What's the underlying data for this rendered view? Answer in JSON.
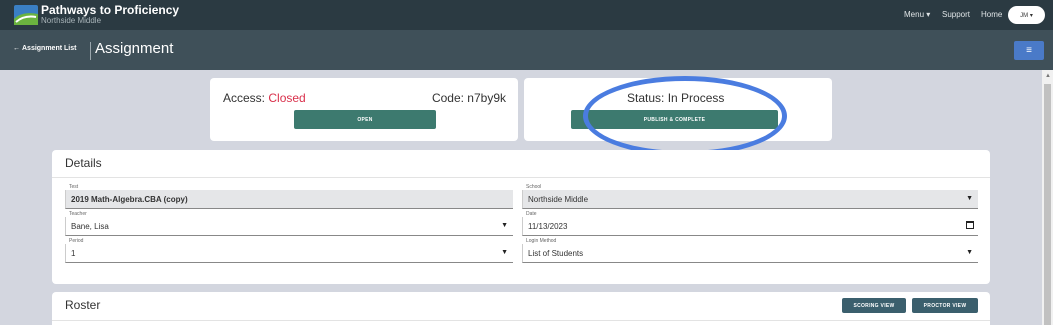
{
  "brand": {
    "title": "Pathways to Proficiency",
    "subtitle": "Northside Middle"
  },
  "nav": {
    "menu": "Menu ▾",
    "support": "Support",
    "home": "Home",
    "avatar": "JM ▾"
  },
  "subheader": {
    "back_label": "Assignment List",
    "back_icon": "←",
    "title": "Assignment",
    "menu_icon": "≡"
  },
  "access": {
    "label": "Access: ",
    "value": "Closed",
    "code": "Code: n7by9k",
    "open_button": "OPEN"
  },
  "status": {
    "label": "Status: In Process",
    "publish_button": "PUBLISH & COMPLETE"
  },
  "details": {
    "title": "Details",
    "test": {
      "label": "Test",
      "value": "2019 Math-Algebra.CBA (copy)"
    },
    "school": {
      "label": "School",
      "value": "Northside Middle"
    },
    "teacher": {
      "label": "Teacher",
      "value": "Bane, Lisa"
    },
    "date": {
      "label": "Date",
      "value": "11/13/2023"
    },
    "period": {
      "label": "Period",
      "value": "1"
    },
    "login_method": {
      "label": "Login Method",
      "value": "List of Students"
    }
  },
  "roster": {
    "title": "Roster",
    "scoring_button": "SCORING VIEW",
    "proctor_button": "PROCTOR VIEW"
  },
  "colors": {
    "accent_teal": "#3d7a6f",
    "closed_red": "#d9304b",
    "annotation_blue": "#4a7ce0",
    "header_dark": "#2b3a42"
  }
}
